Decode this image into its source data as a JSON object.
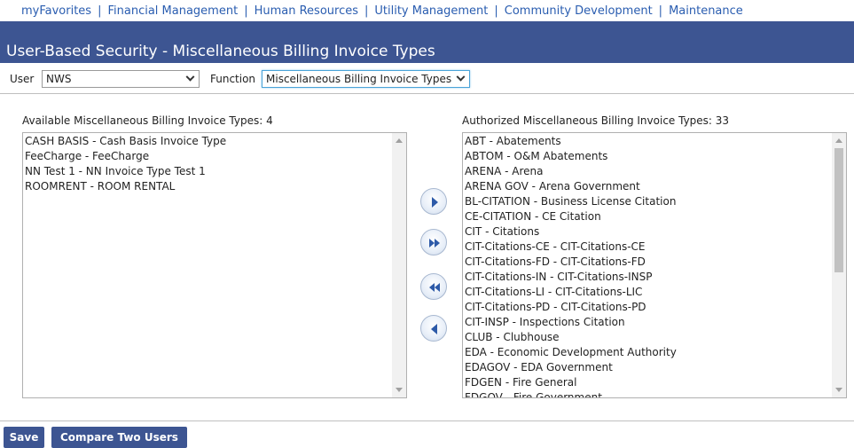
{
  "nav": {
    "items": [
      "myFavorites",
      "Financial Management",
      "Human Resources",
      "Utility Management",
      "Community Development",
      "Maintenance"
    ],
    "separator": "|"
  },
  "page_title": "User-Based Security - Miscellaneous Billing Invoice Types",
  "filters": {
    "user_label": "User",
    "user_value": "NWS",
    "function_label": "Function",
    "function_value": "Miscellaneous Billing Invoice Types"
  },
  "available": {
    "title": "Available Miscellaneous Billing Invoice Types: 4",
    "items": [
      "CASH BASIS - Cash Basis Invoice Type",
      "FeeCharge - FeeCharge",
      "NN Test 1 - NN Invoice Type Test 1",
      "ROOMRENT - ROOM RENTAL"
    ]
  },
  "authorized": {
    "title": "Authorized Miscellaneous Billing Invoice Types: 33",
    "items": [
      "ABT - Abatements",
      "ABTOM - O&M Abatements",
      "ARENA - Arena",
      "ARENA GOV - Arena Government",
      "BL-CITATION - Business License Citation",
      "CE-CITATION - CE Citation",
      "CIT - Citations",
      "CIT-Citations-CE - CIT-Citations-CE",
      "CIT-Citations-FD - CIT-Citations-FD",
      "CIT-Citations-IN - CIT-Citations-INSP",
      "CIT-Citations-LI - CIT-Citations-LIC",
      "CIT-Citations-PD - CIT-Citations-PD",
      "CIT-INSP - Inspections Citation",
      "CLUB - Clubhouse",
      "EDA - Economic Development Authority",
      "EDAGOV - EDA Government",
      "FDGEN - Fire General",
      "FDGOV - Fire Government"
    ],
    "scroll_position": 0
  },
  "icons": {
    "move_right": "chevron-right-icon",
    "move_all_right": "double-chevron-right-icon",
    "move_all_left": "double-chevron-left-icon",
    "move_left": "chevron-left-icon"
  },
  "buttons": {
    "save": "Save",
    "compare": "Compare Two Users"
  },
  "colors": {
    "header_bg": "#3d5592",
    "link": "#2a5db0",
    "button_bg": "#3d5592",
    "icon_blue": "#2d5aa8"
  }
}
